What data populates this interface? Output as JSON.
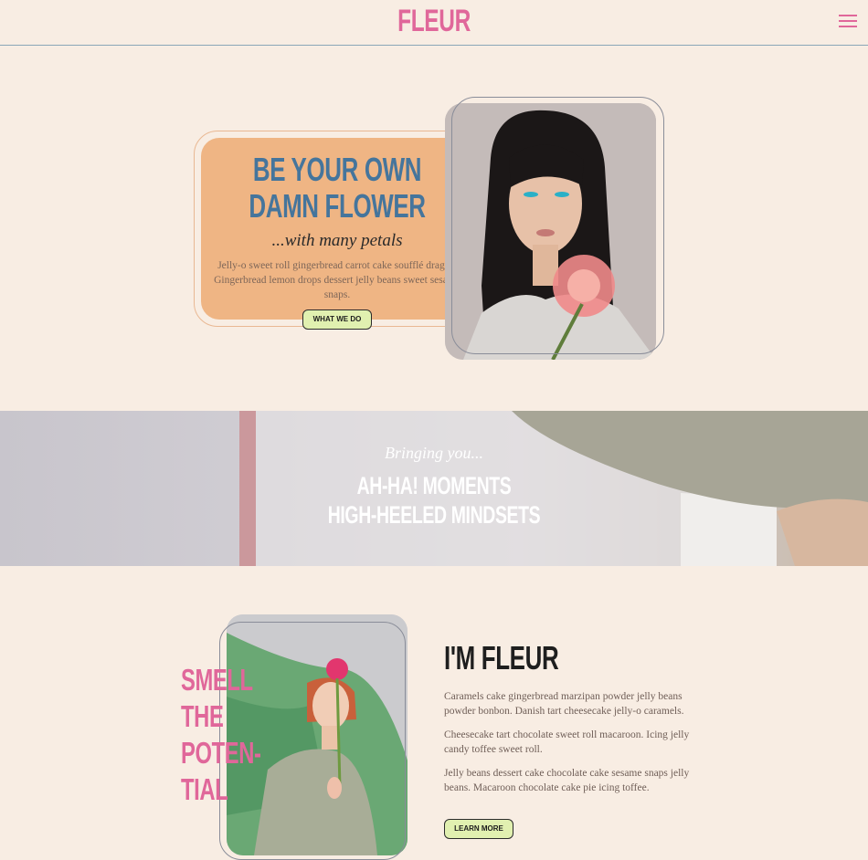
{
  "header": {
    "logo": "FLEUR",
    "menu_icon": "hamburger-menu-icon"
  },
  "hero": {
    "title_line1": "BE YOUR OWN",
    "title_line2": "DAMN FLOWER",
    "subtitle": "...with many petals",
    "body": "Jelly-o sweet roll gingerbread carrot cake soufflé dragée. Gingerbread lemon drops dessert jelly beans sweet sesame snaps.",
    "button_label": "WHAT WE DO"
  },
  "banner": {
    "subtitle": "Bringing you...",
    "line1": "AH-HA! MOMENTS",
    "line2": "HIGH-HEELED MINDSETS"
  },
  "about": {
    "side_words": [
      "SMELL",
      "THE",
      "POTEN-",
      "TIAL"
    ],
    "title": "I'M FLEUR",
    "paragraphs": [
      "Caramels cake gingerbread marzipan powder jelly beans powder bonbon. Danish tart cheesecake jelly-o caramels.",
      "Cheesecake tart chocolate sweet roll macaroon. Icing jelly candy toffee sweet roll.",
      "Jelly beans dessert cake chocolate cake sesame snaps jelly beans. Macaroon chocolate cake pie icing toffee."
    ],
    "button_label": "LEARN MORE"
  },
  "colors": {
    "pink": "#e0679a",
    "blue": "#45759c",
    "peach": "#efb584",
    "cream": "#f8ede3",
    "lime": "#e1f0b0"
  }
}
